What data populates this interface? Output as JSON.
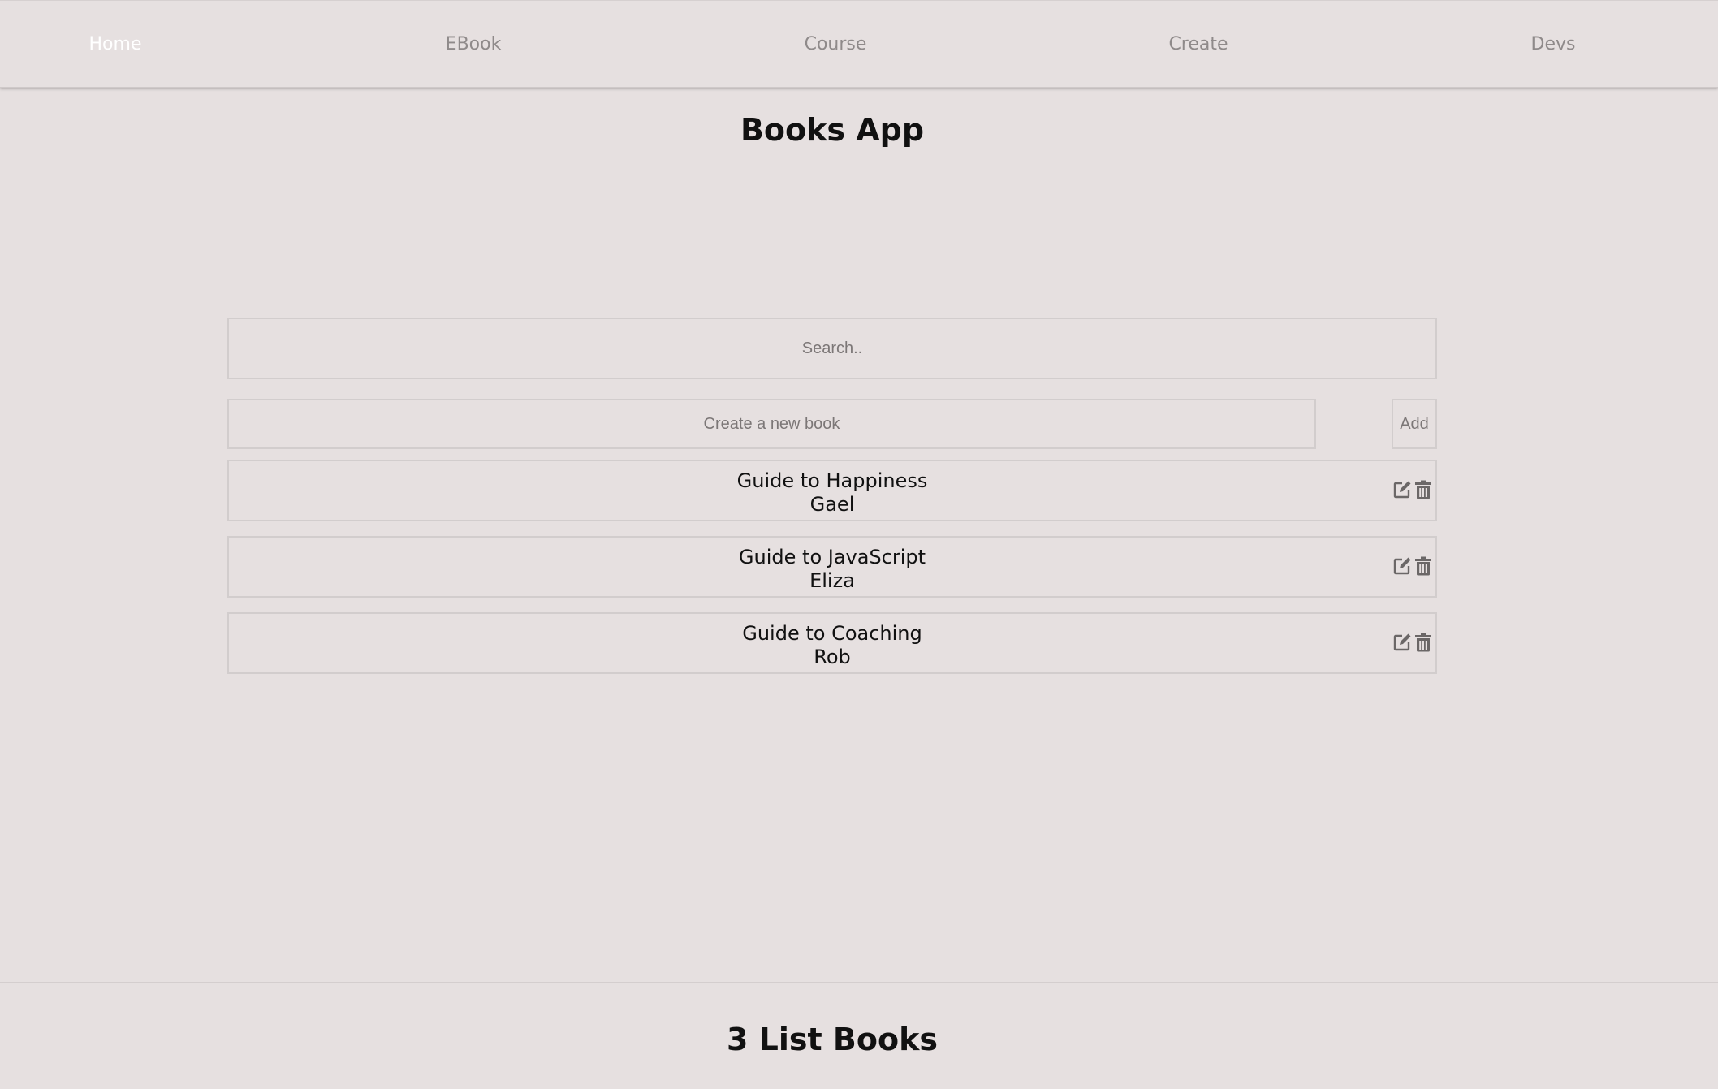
{
  "nav": {
    "items": [
      {
        "label": "Home",
        "active": true
      },
      {
        "label": "EBook",
        "active": false
      },
      {
        "label": "Course",
        "active": false
      },
      {
        "label": "Create",
        "active": false
      },
      {
        "label": "Devs",
        "active": false
      }
    ]
  },
  "header": {
    "title": "Books App"
  },
  "search": {
    "placeholder": "Search.."
  },
  "create": {
    "placeholder": "Create a new book",
    "add_label": "Add"
  },
  "books": [
    {
      "title": "Guide to Happiness",
      "author": "Gael",
      "edit_icon": "edit-icon",
      "delete_icon": "trash-icon"
    },
    {
      "title": "Guide to JavaScript",
      "author": "Eliza",
      "edit_icon": "edit-icon",
      "delete_icon": "trash-icon"
    },
    {
      "title": "Guide to Coaching",
      "author": "Rob",
      "edit_icon": "edit-icon",
      "delete_icon": "trash-icon"
    }
  ],
  "footer": {
    "title": "3 List Books"
  },
  "colors": {
    "background": "#e6e0e0",
    "nav_text": "#8f8a8a",
    "nav_active_text": "#ffffff",
    "border": "#d2cdcd",
    "icon": "#6b6767"
  }
}
